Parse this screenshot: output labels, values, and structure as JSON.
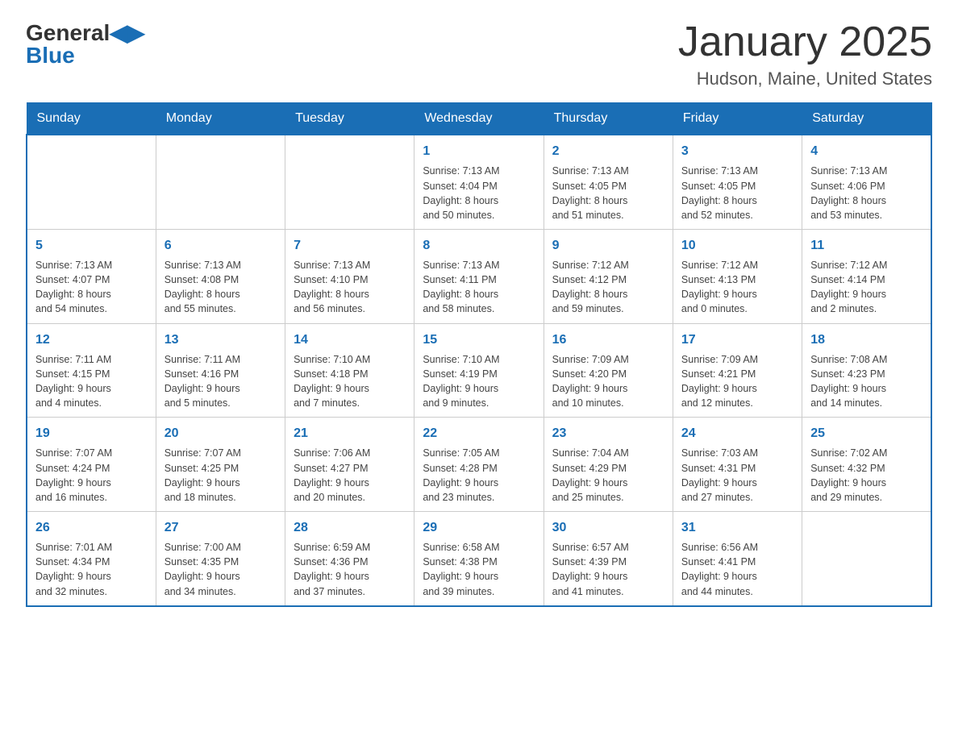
{
  "header": {
    "logo_general": "General",
    "logo_blue": "Blue",
    "title": "January 2025",
    "location": "Hudson, Maine, United States"
  },
  "days_of_week": [
    "Sunday",
    "Monday",
    "Tuesday",
    "Wednesday",
    "Thursday",
    "Friday",
    "Saturday"
  ],
  "weeks": [
    [
      {
        "day": "",
        "info": ""
      },
      {
        "day": "",
        "info": ""
      },
      {
        "day": "",
        "info": ""
      },
      {
        "day": "1",
        "info": "Sunrise: 7:13 AM\nSunset: 4:04 PM\nDaylight: 8 hours\nand 50 minutes."
      },
      {
        "day": "2",
        "info": "Sunrise: 7:13 AM\nSunset: 4:05 PM\nDaylight: 8 hours\nand 51 minutes."
      },
      {
        "day": "3",
        "info": "Sunrise: 7:13 AM\nSunset: 4:05 PM\nDaylight: 8 hours\nand 52 minutes."
      },
      {
        "day": "4",
        "info": "Sunrise: 7:13 AM\nSunset: 4:06 PM\nDaylight: 8 hours\nand 53 minutes."
      }
    ],
    [
      {
        "day": "5",
        "info": "Sunrise: 7:13 AM\nSunset: 4:07 PM\nDaylight: 8 hours\nand 54 minutes."
      },
      {
        "day": "6",
        "info": "Sunrise: 7:13 AM\nSunset: 4:08 PM\nDaylight: 8 hours\nand 55 minutes."
      },
      {
        "day": "7",
        "info": "Sunrise: 7:13 AM\nSunset: 4:10 PM\nDaylight: 8 hours\nand 56 minutes."
      },
      {
        "day": "8",
        "info": "Sunrise: 7:13 AM\nSunset: 4:11 PM\nDaylight: 8 hours\nand 58 minutes."
      },
      {
        "day": "9",
        "info": "Sunrise: 7:12 AM\nSunset: 4:12 PM\nDaylight: 8 hours\nand 59 minutes."
      },
      {
        "day": "10",
        "info": "Sunrise: 7:12 AM\nSunset: 4:13 PM\nDaylight: 9 hours\nand 0 minutes."
      },
      {
        "day": "11",
        "info": "Sunrise: 7:12 AM\nSunset: 4:14 PM\nDaylight: 9 hours\nand 2 minutes."
      }
    ],
    [
      {
        "day": "12",
        "info": "Sunrise: 7:11 AM\nSunset: 4:15 PM\nDaylight: 9 hours\nand 4 minutes."
      },
      {
        "day": "13",
        "info": "Sunrise: 7:11 AM\nSunset: 4:16 PM\nDaylight: 9 hours\nand 5 minutes."
      },
      {
        "day": "14",
        "info": "Sunrise: 7:10 AM\nSunset: 4:18 PM\nDaylight: 9 hours\nand 7 minutes."
      },
      {
        "day": "15",
        "info": "Sunrise: 7:10 AM\nSunset: 4:19 PM\nDaylight: 9 hours\nand 9 minutes."
      },
      {
        "day": "16",
        "info": "Sunrise: 7:09 AM\nSunset: 4:20 PM\nDaylight: 9 hours\nand 10 minutes."
      },
      {
        "day": "17",
        "info": "Sunrise: 7:09 AM\nSunset: 4:21 PM\nDaylight: 9 hours\nand 12 minutes."
      },
      {
        "day": "18",
        "info": "Sunrise: 7:08 AM\nSunset: 4:23 PM\nDaylight: 9 hours\nand 14 minutes."
      }
    ],
    [
      {
        "day": "19",
        "info": "Sunrise: 7:07 AM\nSunset: 4:24 PM\nDaylight: 9 hours\nand 16 minutes."
      },
      {
        "day": "20",
        "info": "Sunrise: 7:07 AM\nSunset: 4:25 PM\nDaylight: 9 hours\nand 18 minutes."
      },
      {
        "day": "21",
        "info": "Sunrise: 7:06 AM\nSunset: 4:27 PM\nDaylight: 9 hours\nand 20 minutes."
      },
      {
        "day": "22",
        "info": "Sunrise: 7:05 AM\nSunset: 4:28 PM\nDaylight: 9 hours\nand 23 minutes."
      },
      {
        "day": "23",
        "info": "Sunrise: 7:04 AM\nSunset: 4:29 PM\nDaylight: 9 hours\nand 25 minutes."
      },
      {
        "day": "24",
        "info": "Sunrise: 7:03 AM\nSunset: 4:31 PM\nDaylight: 9 hours\nand 27 minutes."
      },
      {
        "day": "25",
        "info": "Sunrise: 7:02 AM\nSunset: 4:32 PM\nDaylight: 9 hours\nand 29 minutes."
      }
    ],
    [
      {
        "day": "26",
        "info": "Sunrise: 7:01 AM\nSunset: 4:34 PM\nDaylight: 9 hours\nand 32 minutes."
      },
      {
        "day": "27",
        "info": "Sunrise: 7:00 AM\nSunset: 4:35 PM\nDaylight: 9 hours\nand 34 minutes."
      },
      {
        "day": "28",
        "info": "Sunrise: 6:59 AM\nSunset: 4:36 PM\nDaylight: 9 hours\nand 37 minutes."
      },
      {
        "day": "29",
        "info": "Sunrise: 6:58 AM\nSunset: 4:38 PM\nDaylight: 9 hours\nand 39 minutes."
      },
      {
        "day": "30",
        "info": "Sunrise: 6:57 AM\nSunset: 4:39 PM\nDaylight: 9 hours\nand 41 minutes."
      },
      {
        "day": "31",
        "info": "Sunrise: 6:56 AM\nSunset: 4:41 PM\nDaylight: 9 hours\nand 44 minutes."
      },
      {
        "day": "",
        "info": ""
      }
    ]
  ]
}
